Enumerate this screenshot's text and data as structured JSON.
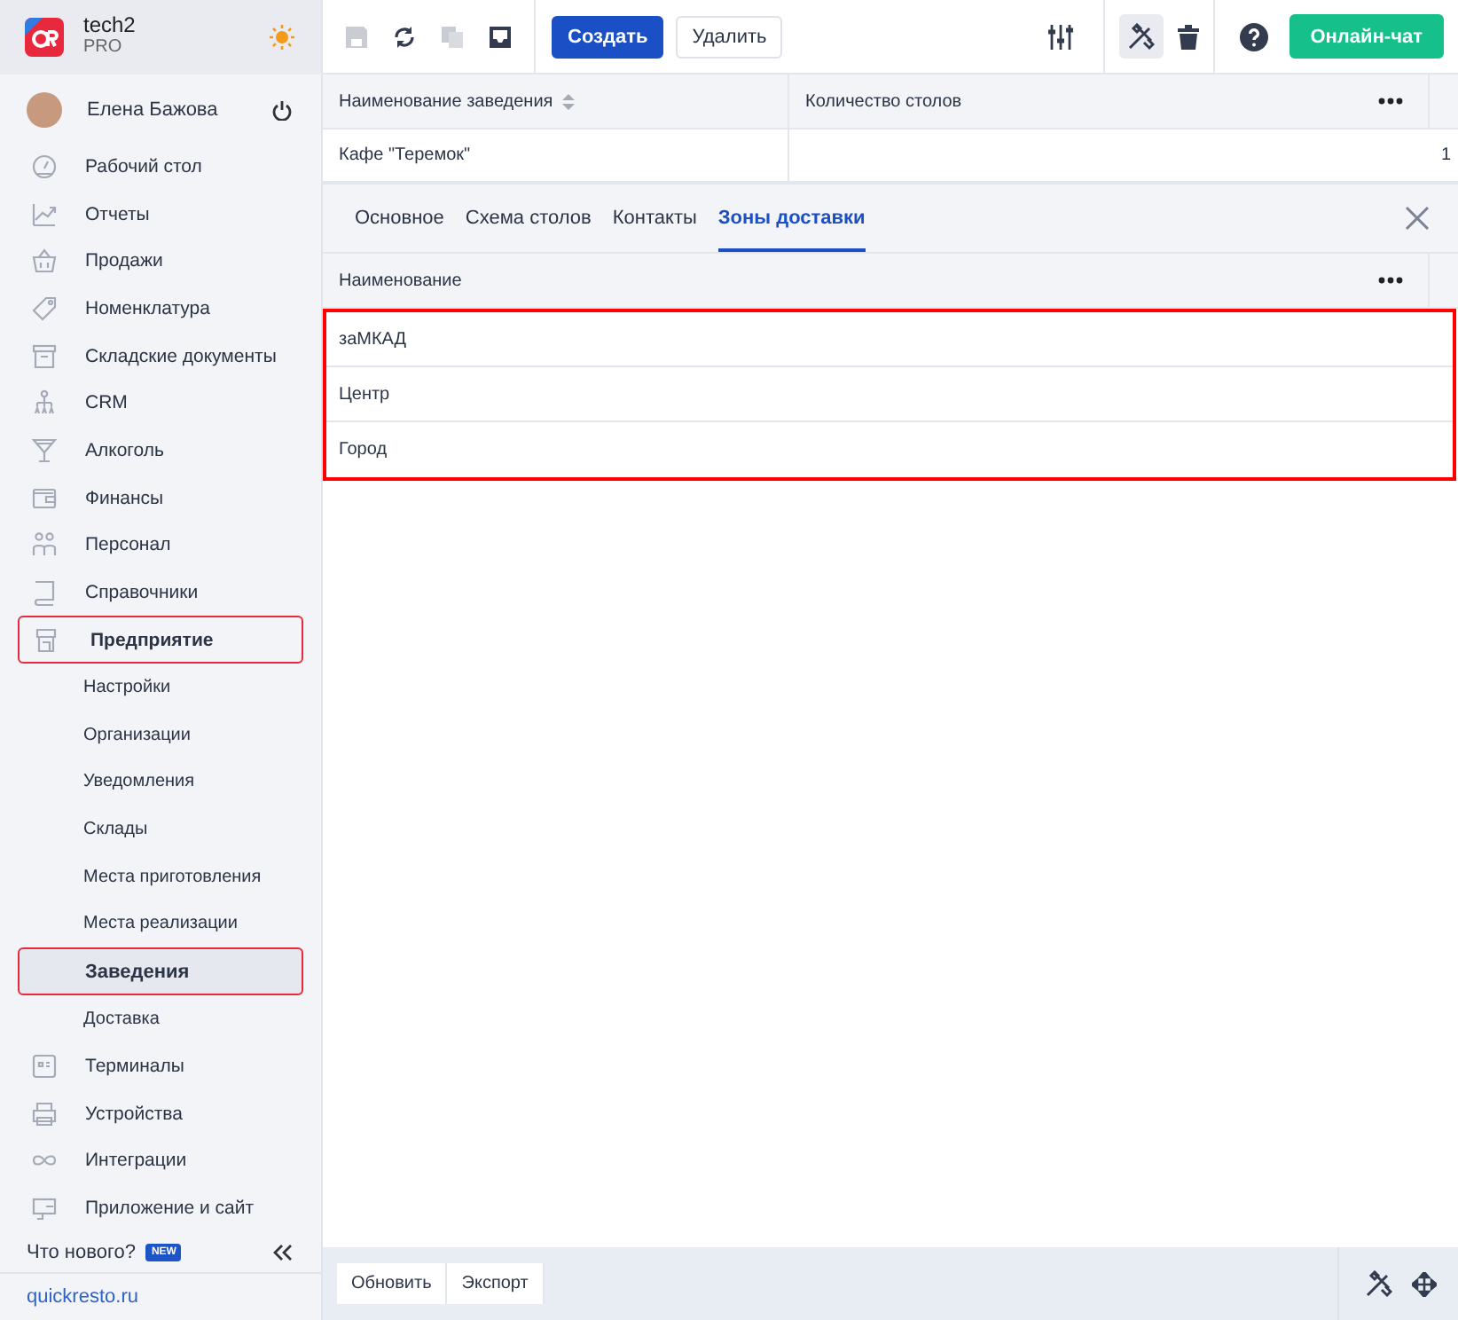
{
  "brand": {
    "name": "tech2",
    "plan": "PRO"
  },
  "user": {
    "name": "Елена Бажова"
  },
  "nav": [
    {
      "label": "Рабочий стол",
      "selected": false,
      "highlighted": false
    },
    {
      "label": "Отчеты",
      "selected": false,
      "highlighted": false
    },
    {
      "label": "Продажи",
      "selected": false,
      "highlighted": false
    },
    {
      "label": "Номенклатура",
      "selected": false,
      "highlighted": false
    },
    {
      "label": "Складские документы",
      "selected": false,
      "highlighted": false
    },
    {
      "label": "CRM",
      "selected": false,
      "highlighted": false
    },
    {
      "label": "Алкоголь",
      "selected": false,
      "highlighted": false
    },
    {
      "label": "Финансы",
      "selected": false,
      "highlighted": false
    },
    {
      "label": "Персонал",
      "selected": false,
      "highlighted": false
    },
    {
      "label": "Справочники",
      "selected": false,
      "highlighted": false
    },
    {
      "label": "Предприятие",
      "selected": false,
      "highlighted": true,
      "children": [
        {
          "label": "Настройки",
          "selected": false,
          "highlighted": false
        },
        {
          "label": "Организации",
          "selected": false,
          "highlighted": false
        },
        {
          "label": "Уведомления",
          "selected": false,
          "highlighted": false
        },
        {
          "label": "Склады",
          "selected": false,
          "highlighted": false
        },
        {
          "label": "Места приготовления",
          "selected": false,
          "highlighted": false
        },
        {
          "label": "Места реализации",
          "selected": false,
          "highlighted": false
        },
        {
          "label": "Заведения",
          "selected": true,
          "highlighted": true
        },
        {
          "label": "Доставка",
          "selected": false,
          "highlighted": false
        }
      ]
    },
    {
      "label": "Терминалы",
      "selected": false,
      "highlighted": false
    },
    {
      "label": "Устройства",
      "selected": false,
      "highlighted": false
    },
    {
      "label": "Интеграции",
      "selected": false,
      "highlighted": false
    },
    {
      "label": "Приложение и сайт",
      "selected": false,
      "highlighted": false
    }
  ],
  "whats_new": {
    "label": "Что нового?",
    "badge": "NEW"
  },
  "site_link": "quickresto.ru",
  "toolbar": {
    "create": "Создать",
    "delete": "Удалить",
    "chat": "Онлайн-чат"
  },
  "table": {
    "columns": [
      "Наименование заведения",
      "Количество столов"
    ],
    "rows": [
      [
        "Кафе \"Теремок\"",
        "1"
      ]
    ]
  },
  "detail": {
    "tabs": [
      {
        "label": "Основное",
        "selected": false
      },
      {
        "label": "Схема столов",
        "selected": false
      },
      {
        "label": "Контакты",
        "selected": false
      },
      {
        "label": "Зоны доставки",
        "selected": true
      }
    ],
    "columns": [
      "Наименование"
    ],
    "highlighted": true,
    "rows": [
      "заМКАД",
      "Центр",
      "Город"
    ]
  },
  "footer": {
    "buttons": [
      "Обновить",
      "Экспорт"
    ]
  }
}
